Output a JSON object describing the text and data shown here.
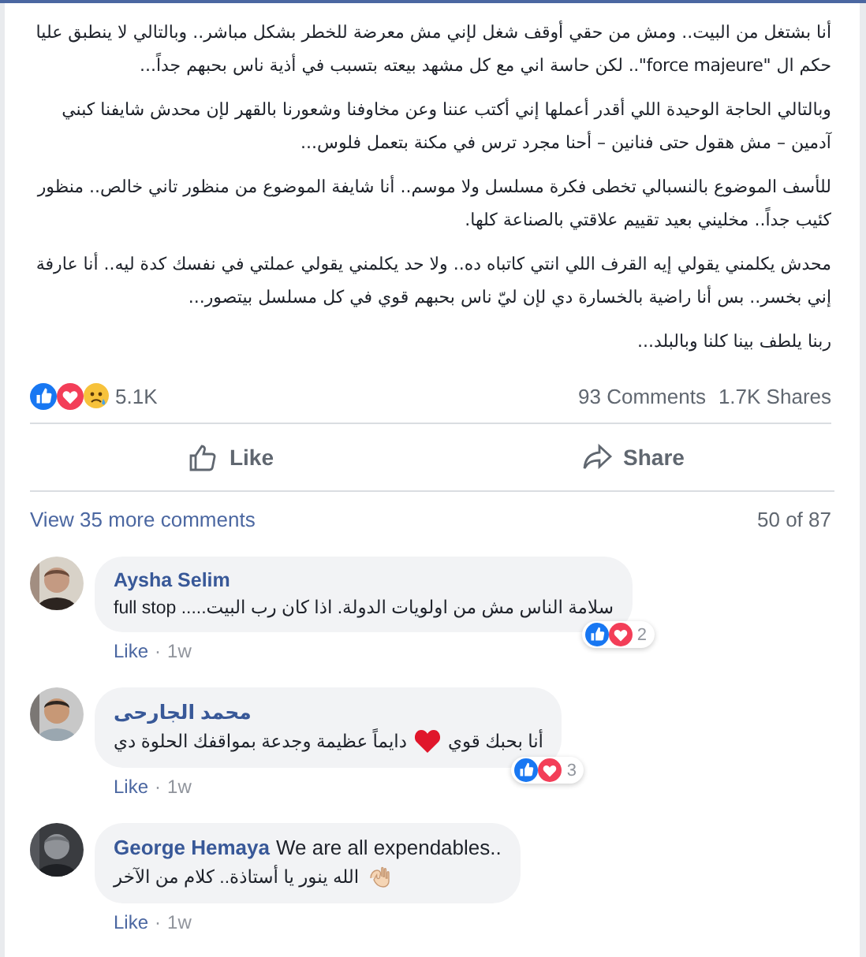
{
  "post": {
    "paragraphs": [
      "أنا بشتغل من البيت.. ومش من حقي أوقف شغل لإني مش معرضة للخطر بشكل مباشر.. وبالتالي لا ينطبق عليا حكم ال \"force majeure\".. لكن حاسة اني مع كل مشهد بيعته بتسبب في أذية ناس بحبهم جداً...",
      "وبالتالي الحاجة الوحيدة اللي أقدر أعملها إني أكتب عننا وعن مخاوفنا وشعورنا بالقهر لإن محدش شايفنا كبني آدمين – مش هقول حتى فنانين – أحنا مجرد ترس في مكنة بتعمل فلوس...",
      "للأسف الموضوع بالنسبالي تخطى فكرة مسلسل ولا موسم.. أنا شايفة الموضوع من منظور تاني خالص.. منظور كئيب جداً.. مخليني بعيد تقييم علاقتي بالصناعة كلها.",
      "محدش يكلمني يقولي إيه القرف اللي انتي كاتباه ده.. ولا حد يكلمني يقولي عملتي في نفسك كدة ليه.. أنا عارفة إني بخسر.. بس أنا راضية بالخسارة دي لإن ليّ ناس بحبهم قوي في كل مسلسل بيتصور...",
      "ربنا يلطف بينا كلنا وبالبلد..."
    ]
  },
  "reactions": {
    "count": "5.1K",
    "comments": "93 Comments",
    "shares": "1.7K Shares"
  },
  "action_bar": {
    "like_button": "Like",
    "share_button": "Share"
  },
  "comments_header": {
    "link": "View 35 more comments",
    "position": "50 of 87"
  },
  "comments": [
    {
      "kind": "stacked",
      "author": "Aysha Selim",
      "text": "سلامة الناس مش من اولويات الدولة. اذا كان رب البيت..... full stop",
      "reaction_count": "2",
      "action": "Like",
      "separator": "·",
      "time": "1w"
    },
    {
      "kind": "heart",
      "author": "محمد الجارحى",
      "text_parts": [
        "أنا بحبك قوي",
        "دايماً عظيمة وجدعة بمواقفك الحلوة دي"
      ],
      "reaction_count": "3",
      "action": "Like",
      "separator": "·",
      "time": "1w"
    },
    {
      "kind": "inline",
      "author": "George Hemaya",
      "text": "We are all expendables..",
      "second_line": "الله ينور يا أستاذة.. كلام من الآخر",
      "action": "Like",
      "separator": "·",
      "time": "1w"
    }
  ]
}
